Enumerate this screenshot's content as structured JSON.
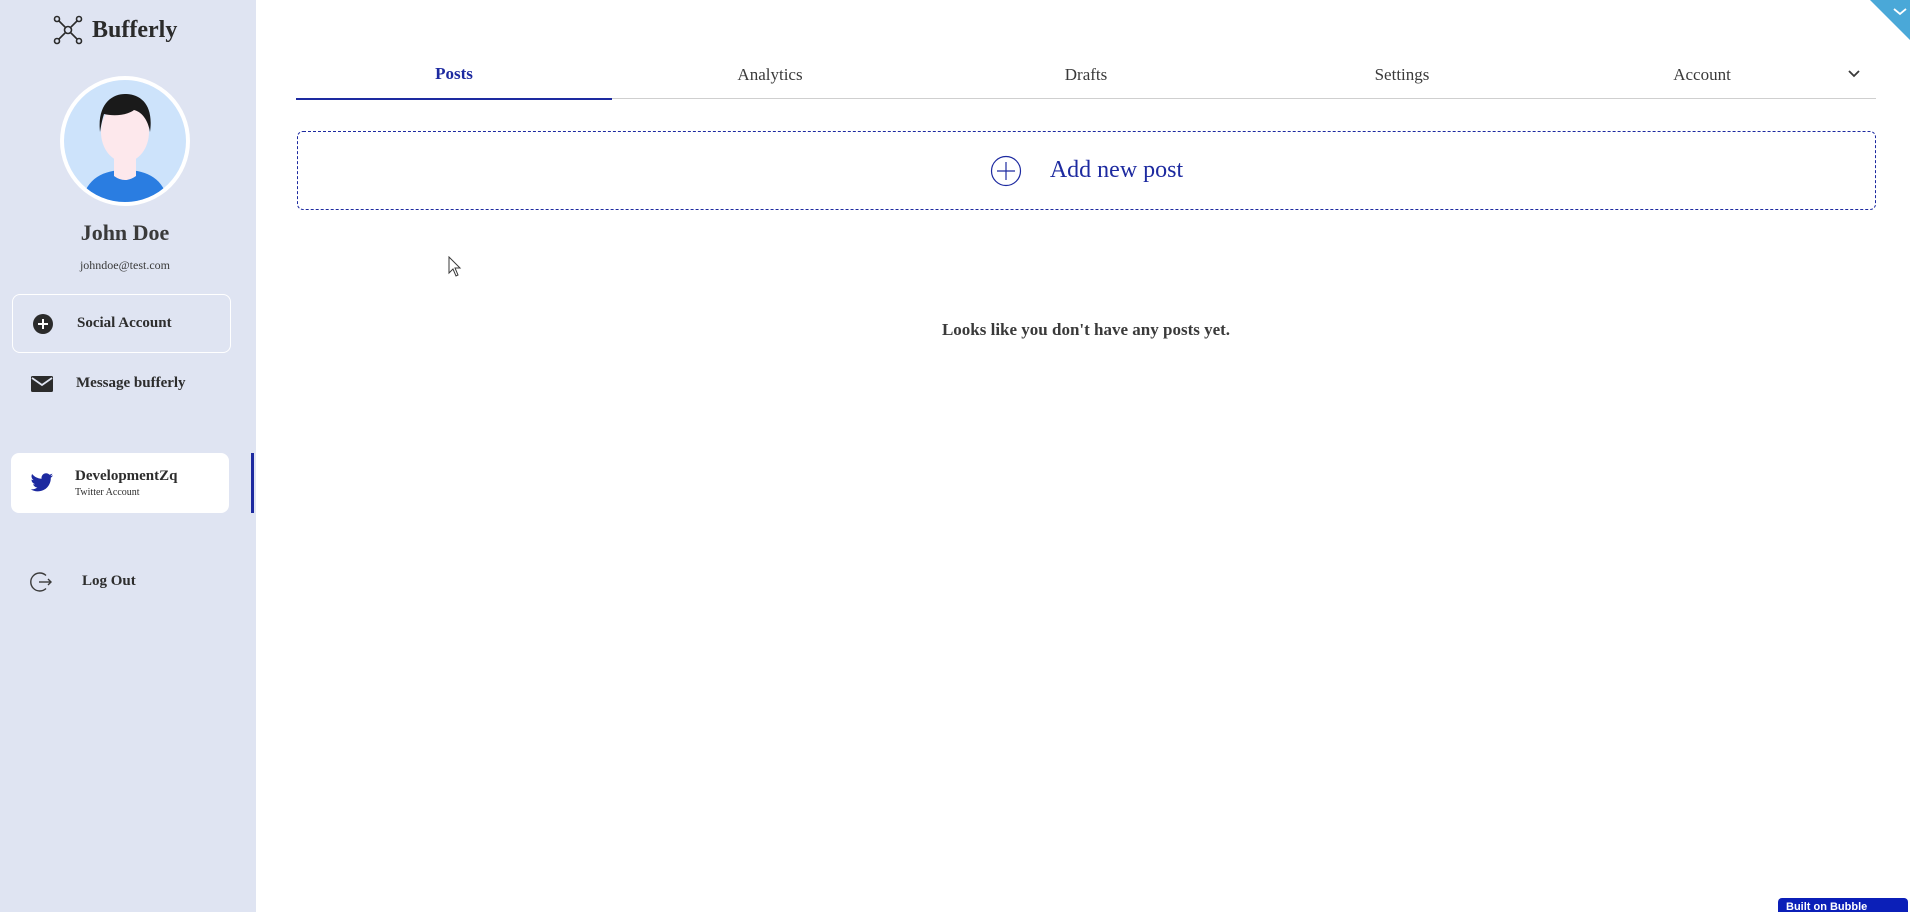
{
  "app": {
    "name": "Bufferly"
  },
  "user": {
    "name": "John Doe",
    "email": "johndoe@test.com"
  },
  "sidebar": {
    "social_account_label": "Social Account",
    "message_label": "Message bufferly",
    "accounts": [
      {
        "name": "DevelopmentZq",
        "type": "Twitter Account",
        "active": true
      }
    ],
    "logout_label": "Log Out"
  },
  "tabs": [
    {
      "label": "Posts",
      "active": true
    },
    {
      "label": "Analytics",
      "active": false
    },
    {
      "label": "Drafts",
      "active": false
    },
    {
      "label": "Settings",
      "active": false
    },
    {
      "label": "Account",
      "active": false
    }
  ],
  "main": {
    "add_post_label": "Add new post",
    "empty_message": "Looks like you don't have any posts yet."
  },
  "footer": {
    "bubble_badge": "Built on Bubble"
  },
  "colors": {
    "accent": "#1d2aa0",
    "sidebar_bg": "#dfe4f2",
    "twitter": "#1d2aa0",
    "corner_badge": "#4aa8d8"
  },
  "icons": {
    "brand": "network-nodes-icon",
    "social_account": "plus-circle-icon",
    "message": "envelope-icon",
    "account": "twitter-bird-icon",
    "logout": "logout-arrow-icon",
    "add_post": "plus-circle-outline-icon",
    "tab_menu": "chevron-down-icon"
  }
}
